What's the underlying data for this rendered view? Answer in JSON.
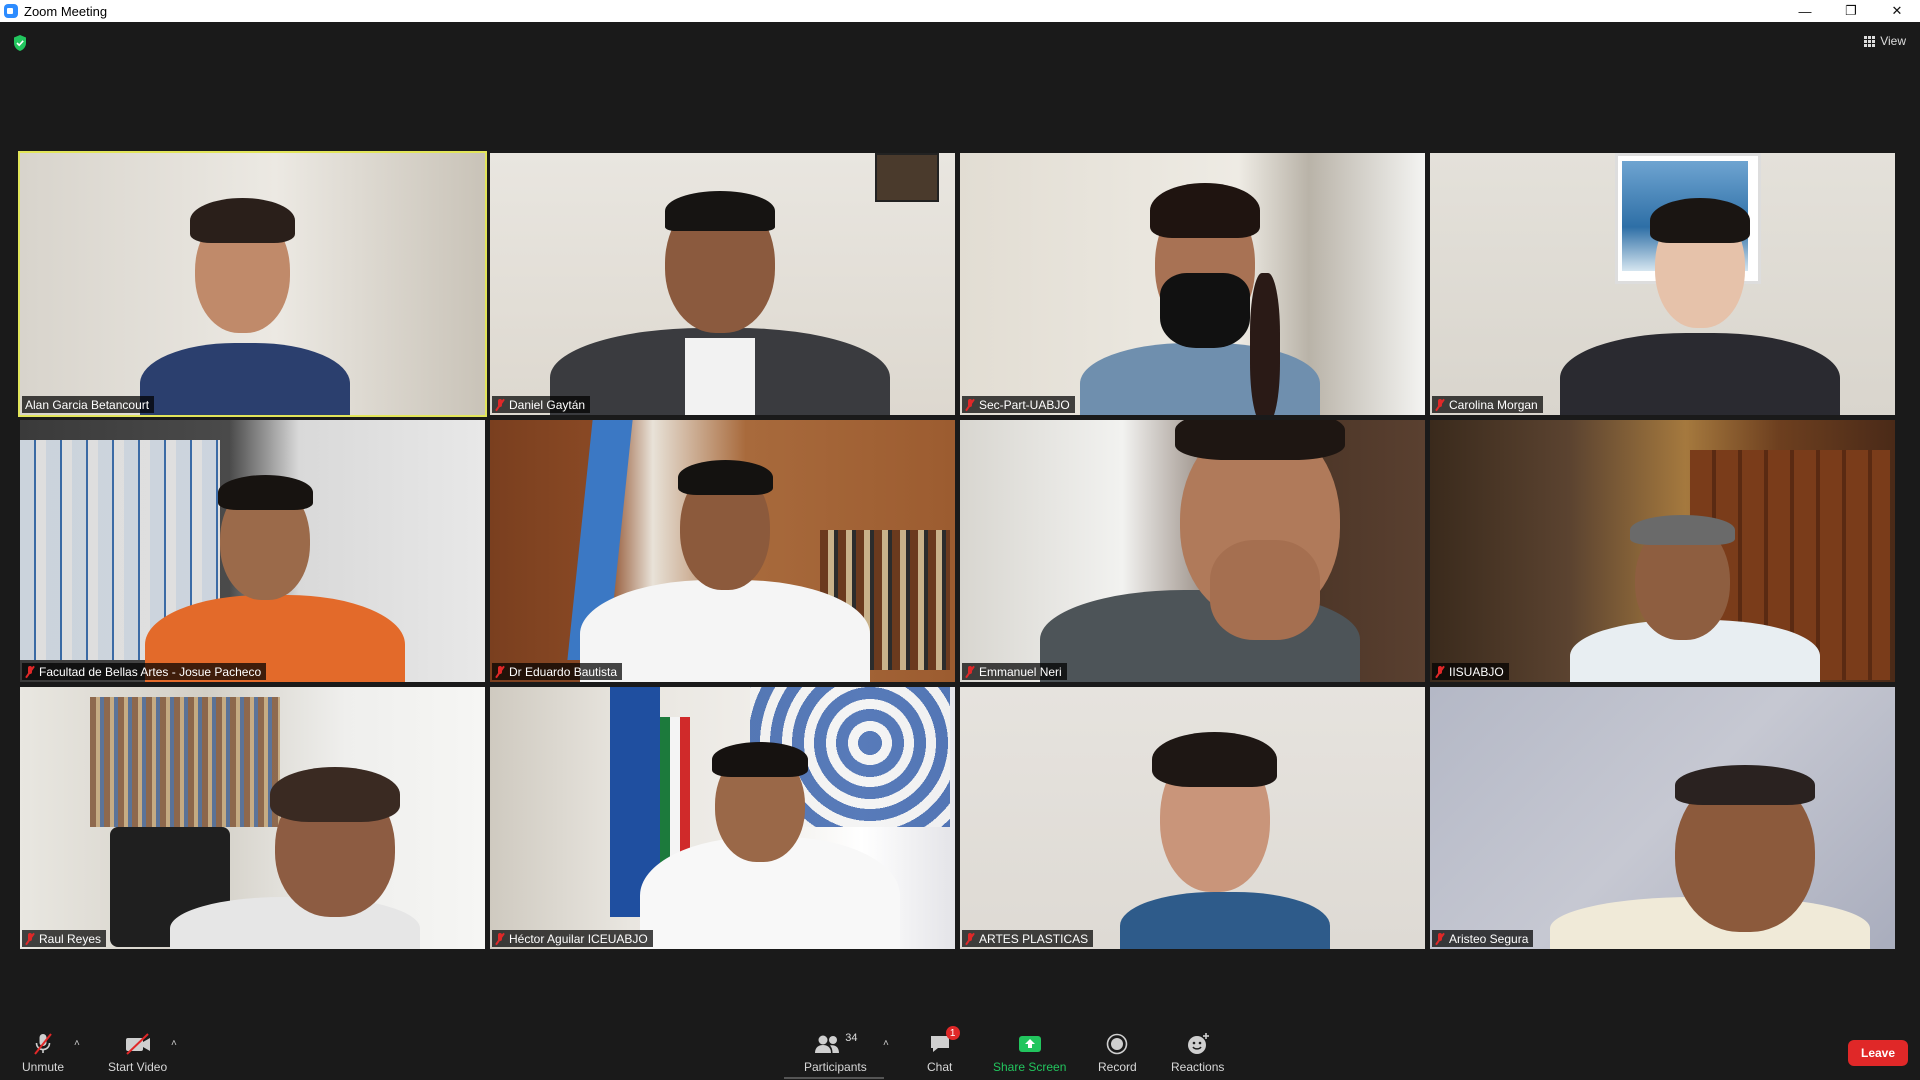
{
  "window": {
    "title": "Zoom Meeting"
  },
  "topbar": {
    "view_label": "View"
  },
  "participants_tiles": [
    {
      "name": "Alan Garcia Betancourt",
      "muted": false,
      "active_speaker": true
    },
    {
      "name": "Daniel Gaytán",
      "muted": true
    },
    {
      "name": "Sec-Part-UABJO",
      "muted": true
    },
    {
      "name": "Carolina Morgan",
      "muted": true
    },
    {
      "name": "Facultad de Bellas Artes - Josue Pacheco",
      "muted": true
    },
    {
      "name": "Dr Eduardo Bautista",
      "muted": true
    },
    {
      "name": "Emmanuel Neri",
      "muted": true
    },
    {
      "name": "IISUABJO",
      "muted": true
    },
    {
      "name": "Raul Reyes",
      "muted": true
    },
    {
      "name": "Héctor Aguilar ICEUABJO",
      "muted": true
    },
    {
      "name": "ARTES PLASTICAS",
      "muted": true
    },
    {
      "name": "Aristeo Segura",
      "muted": true
    }
  ],
  "toolbar": {
    "unmute_label": "Unmute",
    "start_video_label": "Start Video",
    "participants_label": "Participants",
    "participants_count": "34",
    "chat_label": "Chat",
    "chat_badge": "1",
    "share_screen_label": "Share Screen",
    "record_label": "Record",
    "reactions_label": "Reactions",
    "leave_label": "Leave"
  },
  "colors": {
    "active_speaker_border": "#e2e55a",
    "leave_red": "#e02828",
    "share_green": "#22c55e",
    "background": "#1a1a1a"
  },
  "icons": {
    "shield": "shield-check-icon",
    "view": "grid-view-icon",
    "mic": "mic-off-icon",
    "video": "video-off-icon",
    "participants": "participants-icon",
    "chat": "chat-icon",
    "share": "share-screen-icon",
    "record": "record-icon",
    "reactions": "reactions-icon"
  }
}
